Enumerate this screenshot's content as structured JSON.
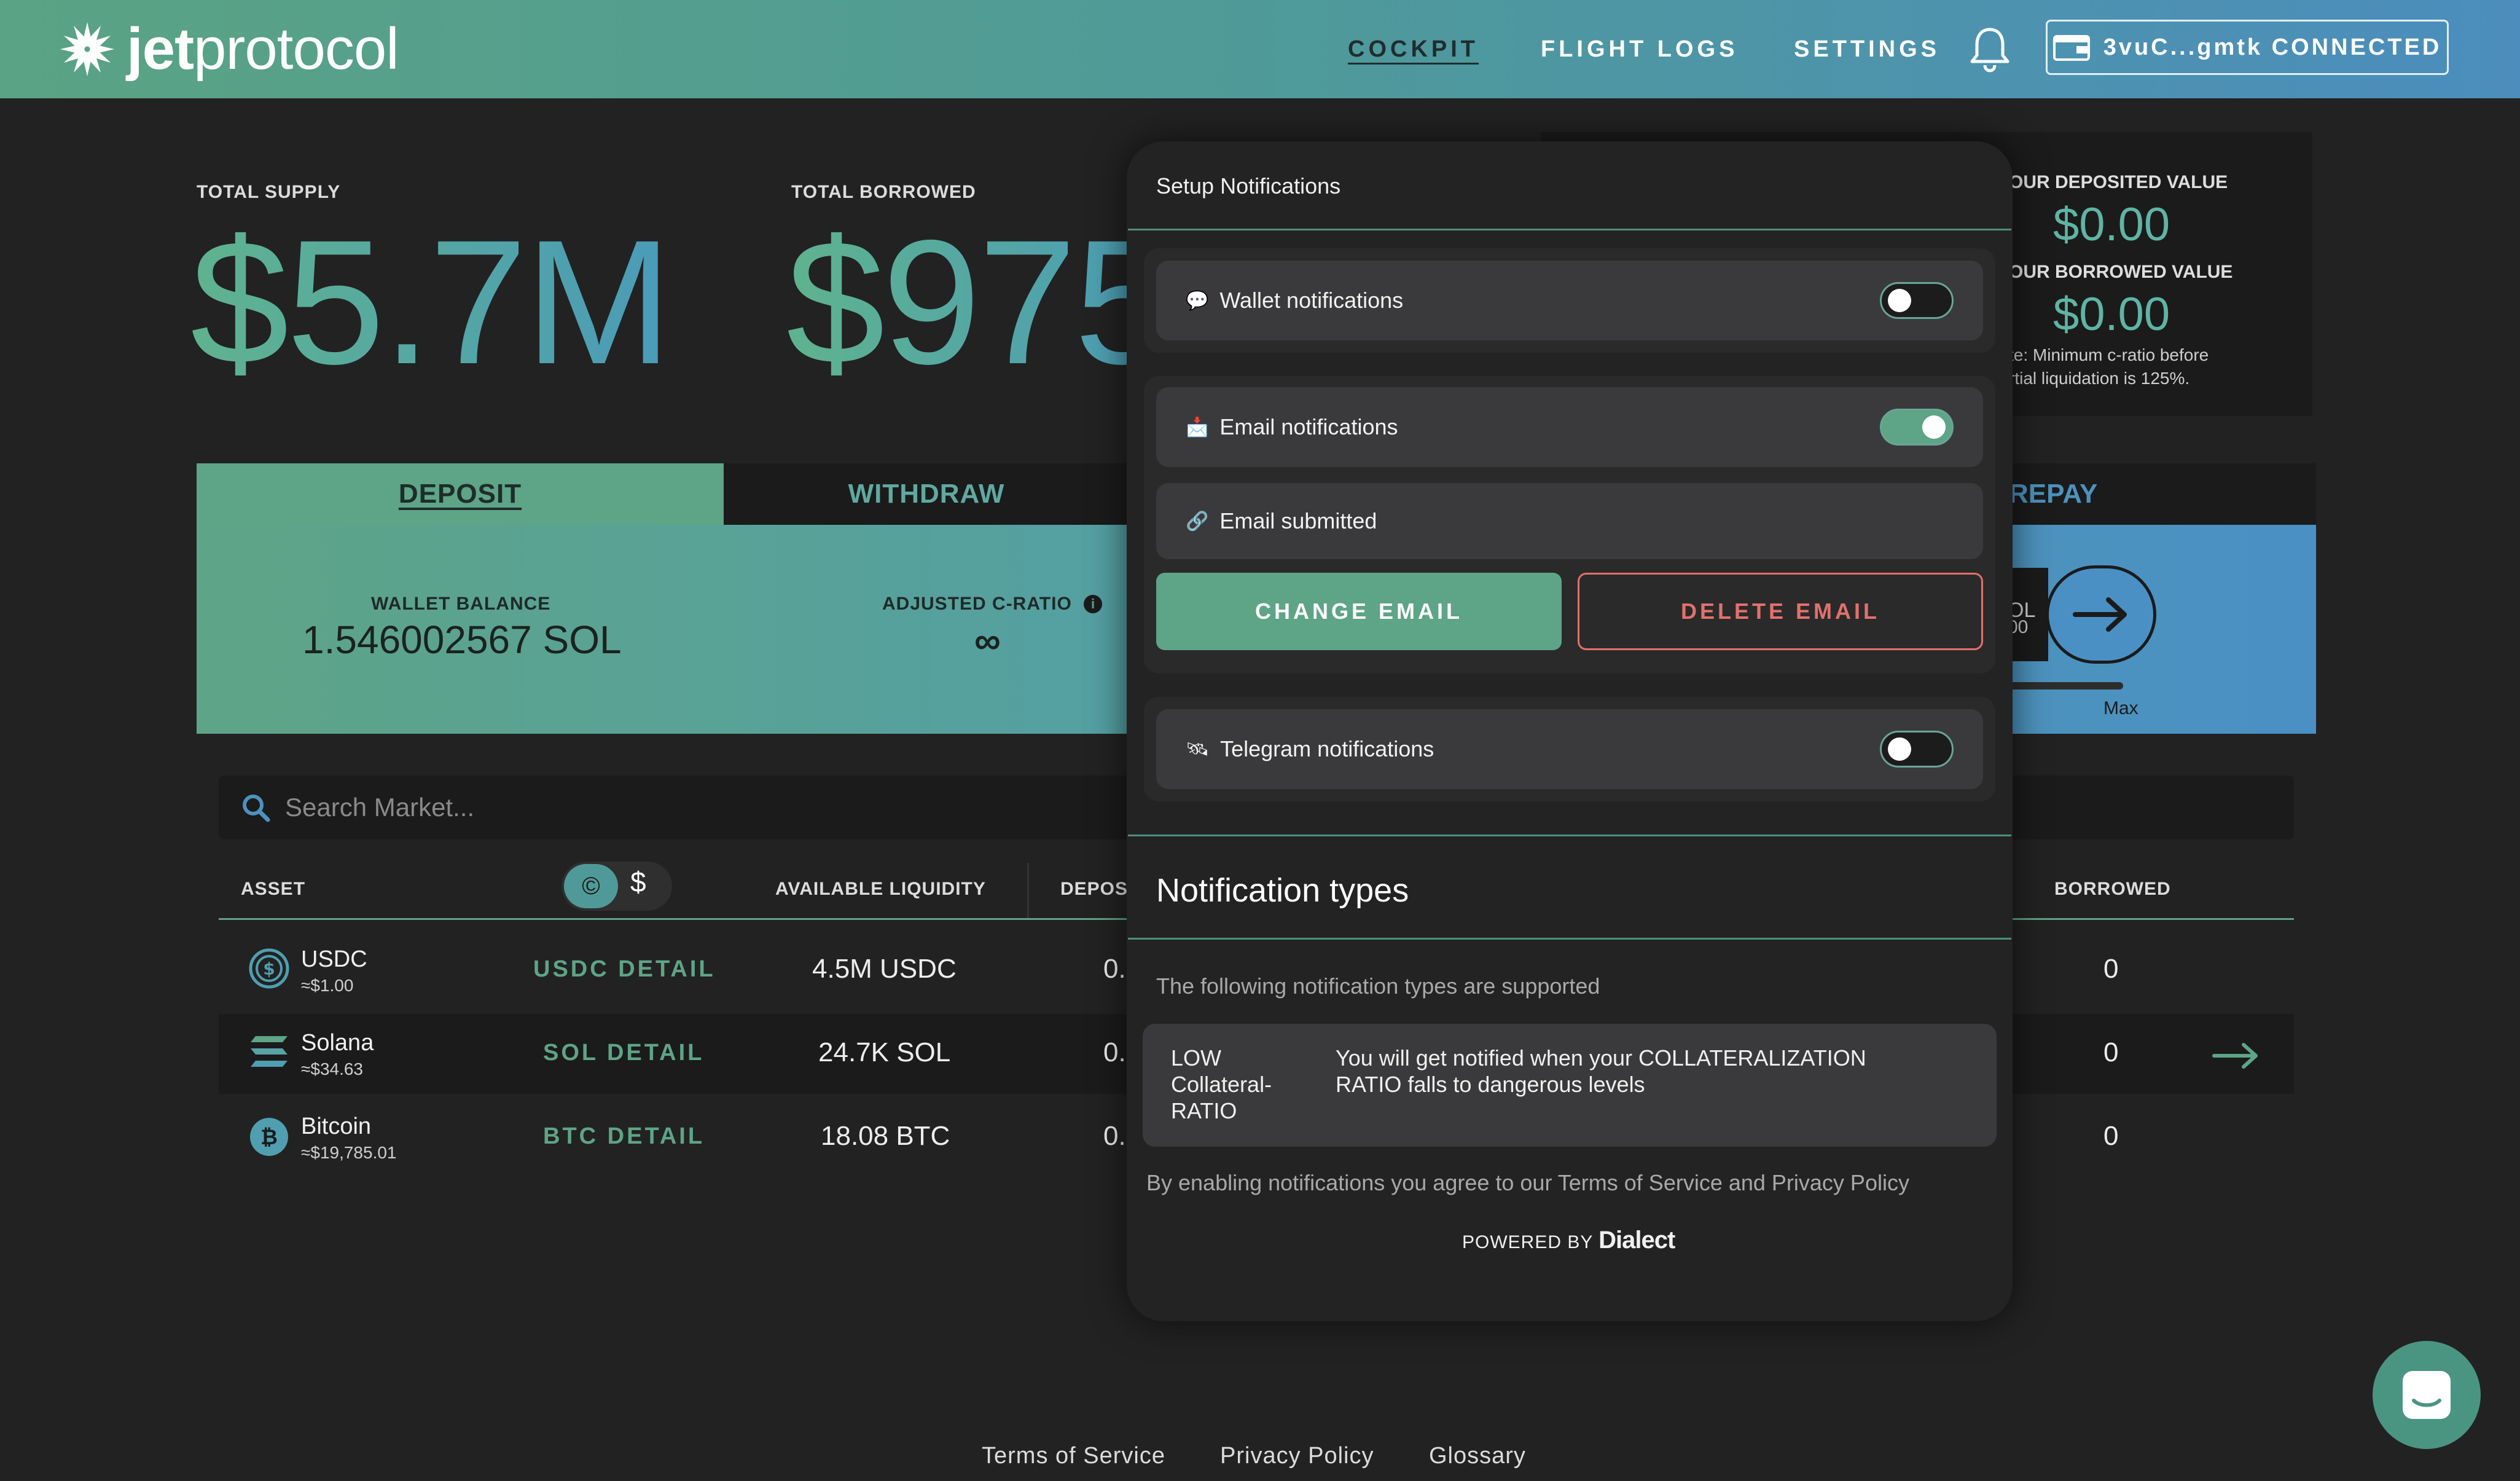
{
  "header": {
    "logo_bold": "jet",
    "logo_light": "protocol",
    "nav": [
      "COCKPIT",
      "FLIGHT LOGS",
      "SETTINGS"
    ],
    "wallet_label": "3vuC...gmtk CONNECTED"
  },
  "stats": {
    "total_supply_label": "TOTAL SUPPLY",
    "total_supply_value": "$5.7M",
    "total_borrowed_label": "TOTAL BORROWED",
    "total_borrowed_value": "$975"
  },
  "account": {
    "deposited_label": "OUR DEPOSITED VALUE",
    "deposited_value": "$0.00",
    "borrowed_label": "OUR BORROWED VALUE",
    "borrowed_value": "$0.00",
    "note_line1": "te: Minimum c-ratio before",
    "note_line2": "rtial liquidation is 125%."
  },
  "tabs": {
    "deposit": "DEPOSIT",
    "withdraw": "WITHDRAW",
    "repay": "REPAY"
  },
  "trade": {
    "wallet_balance_label": "WALLET BALANCE",
    "wallet_balance_value": "1.546002567 SOL",
    "c_ratio_label": "ADJUSTED C-RATIO",
    "c_ratio_value": "∞",
    "input_fragment": "OL",
    "input_fragment2": "00",
    "max_label": "Max"
  },
  "search": {
    "placeholder": "Search Market..."
  },
  "table": {
    "headers": {
      "asset": "ASSET",
      "liquidity": "AVAILABLE LIQUIDITY",
      "deposited": "DEPOS",
      "borrowed": "BORROWED"
    },
    "rows": [
      {
        "name": "USDC",
        "price": "≈$1.00",
        "detail": "USDC DETAIL",
        "liquidity": "4.5M USDC",
        "deposited": "0.",
        "borrowed": "0"
      },
      {
        "name": "Solana",
        "price": "≈$34.63",
        "detail": "SOL DETAIL",
        "liquidity": "24.7K SOL",
        "deposited": "0.",
        "borrowed": "0"
      },
      {
        "name": "Bitcoin",
        "price": "≈$19,785.01",
        "detail": "BTC DETAIL",
        "liquidity": "18.08 BTC",
        "deposited": "0.",
        "borrowed": "0"
      }
    ],
    "unit_symbols": [
      "©",
      "$"
    ]
  },
  "modal": {
    "title": "Setup Notifications",
    "wallet_notifications": {
      "emoji": "💬",
      "label": "Wallet notifications",
      "enabled": false
    },
    "email_notifications": {
      "emoji": "📩",
      "label": "Email notifications",
      "enabled": true
    },
    "email_status": {
      "emoji": "🔗",
      "label": "Email submitted"
    },
    "change_email": "CHANGE EMAIL",
    "delete_email": "DELETE EMAIL",
    "telegram_notifications": {
      "emoji": "🛰",
      "label": "Telegram notifications",
      "enabled": false
    },
    "types_title": "Notification types",
    "types_subtitle": "The following notification types are supported",
    "types": [
      {
        "key_line1": "LOW",
        "key_line2": "Collateral-",
        "key_line3": "RATIO",
        "desc_line1": "You will get notified when your COLLATERALIZATION",
        "desc_line2": "RATIO falls to dangerous levels"
      }
    ],
    "agreement": "By enabling notifications you agree to our Terms of Service and Privacy Policy",
    "powered_prefix": "POWERED BY",
    "powered_brand": "Dialect"
  },
  "footer": {
    "links": [
      "Terms of Service",
      "Privacy Policy",
      "Glossary"
    ]
  },
  "colors": {
    "accent_green": "#5ea487",
    "accent_blue": "#4a90c4",
    "danger": "#e2716d",
    "background": "#222222"
  }
}
